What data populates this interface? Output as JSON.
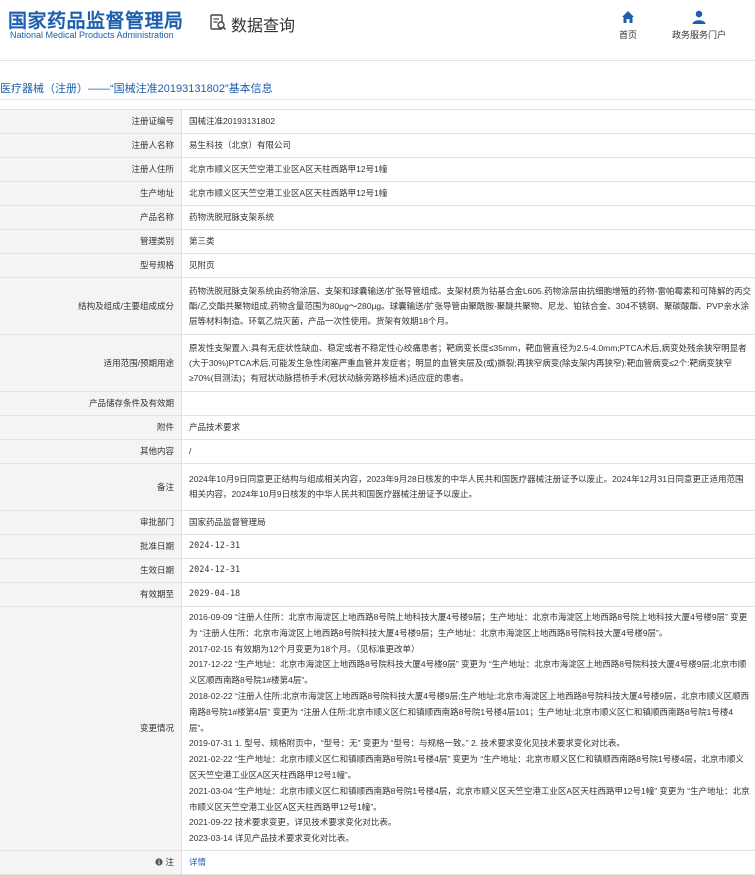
{
  "header": {
    "logo_cn": "国家药品监督管理局",
    "logo_en": "National Medical Products Administration",
    "section_title": "数据查询",
    "nav": [
      {
        "label": "首页",
        "icon": "home-icon"
      },
      {
        "label": "政务服务门户",
        "icon": "user-icon"
      }
    ]
  },
  "breadcrumb": "医疗器械（注册）——“国械注准20193131802”基本信息",
  "rows": [
    {
      "key": "注册证编号",
      "value": "国械注准20193131802"
    },
    {
      "key": "注册人名称",
      "value": "易生科技（北京）有限公司"
    },
    {
      "key": "注册人住所",
      "value": "北京市顺义区天竺空港工业区A区天柱西路甲12号1幢"
    },
    {
      "key": "生产地址",
      "value": "北京市顺义区天竺空港工业区A区天柱西路甲12号1幢"
    },
    {
      "key": "产品名称",
      "value": "药物洗脱冠脉支架系统"
    },
    {
      "key": "管理类别",
      "value": "第三类"
    },
    {
      "key": "型号规格",
      "value": "见附页"
    },
    {
      "key": "结构及组成/主要组成成分",
      "value": "药物洗脱冠脉支架系统由药物涂层、支架和球囊输送/扩张导管组成。支架材质为钴基合金L605.药物涂层由抗细胞增殖的药物-雷帕霉素和可降解的丙交酯/乙交酯共聚物组成,药物含量范围为80μg～280μg。球囊输送/扩张导管由聚酰胺-聚醚共聚物、尼龙、铂铱合金、304不锈钢、聚碳酸酯、PVP亲水涂层等材料制造。环氧乙烷灭菌，产品一次性使用。货架有效期18个月。"
    },
    {
      "key": "适用范围/预期用途",
      "value": "原发性支架置入:具有无症状性缺血、稳定或者不稳定性心绞痛患者；靶病变长度≤35mm，靶血管直径为2.5-4.0mm;PTCA术后,病变处残余狭窄明显者(大于30%)PTCA术后,可能发生急性闭塞严重血管并发症者；明显的血管夹层及(或)撕裂;再狭窄病变(除支架内再狭窄):靶血管病变≤2个:靶病变狭窄≥70%(目测法)；有冠状动脉搭桥手术(冠状动脉旁路移植术)适应症的患者。"
    },
    {
      "key": "产品储存条件及有效期",
      "value": ""
    },
    {
      "key": "附件",
      "value": "产品技术要求"
    },
    {
      "key": "其他内容",
      "value": "/"
    },
    {
      "key": "备注",
      "value": "2024年10月9日同意更正结构与组成相关内容，2023年9月28日核发的中华人民共和国医疗器械注册证予以废止。2024年12月31日同意更正适用范围相关内容，2024年10月9日核发的中华人民共和国医疗器械注册证予以废止。"
    },
    {
      "key": "审批部门",
      "value": "国家药品监督管理局"
    },
    {
      "key": "批准日期",
      "value": "2024-12-31"
    },
    {
      "key": "生效日期",
      "value": "2024-12-31"
    },
    {
      "key": "有效期至",
      "value": "2029-04-18"
    }
  ],
  "change_key": "变更情况",
  "changes": [
    "2016-09-09 “注册人住所：北京市海淀区上地西路8号院上地科技大厦4号楼9层；生产地址：北京市海淀区上地西路8号院上地科技大厦4号楼9层” 变更为 “注册人住所：北京市海淀区上地西路8号院科技大厦4号楼9层；生产地址：北京市海淀区上地西路8号院科技大厦4号楼9层”。",
    "2017-02-15 有效期为12个月变更为18个月。（见标准更改单）",
    "2017-12-22 “生产地址：北京市海淀区上地西路8号院科技大厦4号楼9层” 变更为 “生产地址：北京市海淀区上地西路8号院科技大厦4号楼9层;北京市顺义区顺西南路8号院1#楼第4层”。",
    "2018-02-22 “注册人住所:北京市海淀区上地西路8号院科技大厦4号楼9层;生产地址:北京市海淀区上地西路8号院科技大厦4号楼9层，北京市顺义区顺西南路8号院1#楼第4层” 变更为 “注册人住所:北京市顺义区仁和镇顺西南路8号院1号楼4层101；生产地址:北京市顺义区仁和镇顺西南路8号院1号楼4层”。",
    "2019-07-31 1. 型号、规格附页中，“型号：无” 变更为 “型号：与规格一致。” 2. 技术要求变化见技术要求变化对比表。",
    "2021-02-22 “生产地址：北京市顺义区仁和镇顺西南路8号院1号楼4层” 变更为 “生产地址：北京市顺义区仁和镇顺西南路8号院1号楼4层，北京市顺义区天竺空港工业区A区天柱西路甲12号1幢”。",
    "2021-03-04 “生产地址：北京市顺义区仁和镇顺西南路8号院1号楼4层，北京市顺义区天竺空港工业区A区天柱西路甲12号1幢” 变更为 “生产地址：北京市顺义区天竺空港工业区A区天柱西路甲12号1幢”。",
    "2021-09-22 技术要求变更，详见技术要求变化对比表。",
    "2023-03-14 详见产品技术要求变化对比表。"
  ],
  "note_key": "注",
  "note_link": "详情"
}
